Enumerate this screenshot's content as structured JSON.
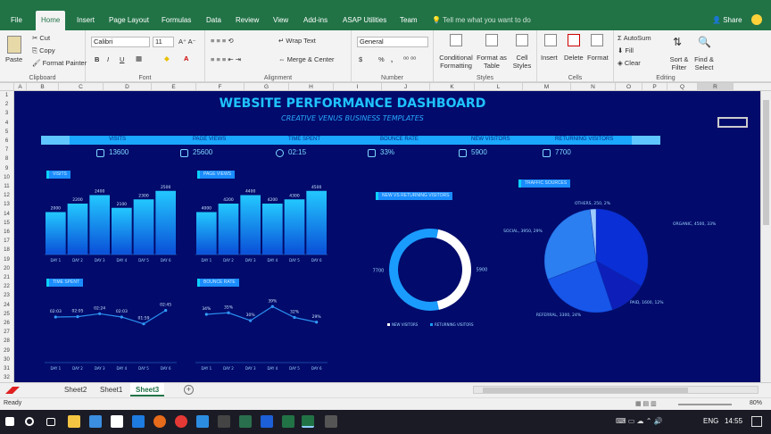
{
  "menu": [
    "File",
    "Home",
    "Insert",
    "Page Layout",
    "Formulas",
    "Data",
    "Review",
    "View",
    "Add-ins",
    "ASAP Utilities",
    "Team"
  ],
  "tell_me": "Tell me what you want to do",
  "share": "Share",
  "ribbon": {
    "clipboard": {
      "paste": "Paste",
      "cut": "Cut",
      "copy": "Copy",
      "format_painter": "Format Painter",
      "label": "Clipboard"
    },
    "font": {
      "name": "Calibri",
      "size": "11",
      "label": "Font",
      "bold": "B",
      "italic": "I",
      "underline": "U"
    },
    "alignment": {
      "wrap": "Wrap Text",
      "merge": "Merge & Center",
      "label": "Alignment"
    },
    "number": {
      "format": "General",
      "label": "Number",
      "percent": "%",
      "comma": ","
    },
    "styles": {
      "conditional": "Conditional Formatting",
      "format_table": "Format as Table",
      "cell_styles": "Cell Styles",
      "label": "Styles"
    },
    "cells": {
      "insert": "Insert",
      "delete": "Delete",
      "format": "Format",
      "label": "Cells"
    },
    "editing": {
      "autosum": "AutoSum",
      "fill": "Fill",
      "clear": "Clear",
      "sort": "Sort & Filter",
      "find": "Find & Select",
      "label": "Editing"
    }
  },
  "columns": [
    "A",
    "B",
    "C",
    "D",
    "E",
    "F",
    "G",
    "H",
    "I",
    "J",
    "K",
    "L",
    "M",
    "N",
    "O",
    "P",
    "Q",
    "R"
  ],
  "rows": [
    "1",
    "2",
    "3",
    "4",
    "5",
    "6",
    "7",
    "8",
    "9",
    "10",
    "11",
    "12",
    "13",
    "14",
    "15",
    "16",
    "17",
    "18",
    "19",
    "20",
    "21",
    "22",
    "23",
    "24",
    "25",
    "26",
    "27",
    "28",
    "29",
    "30",
    "31",
    "32"
  ],
  "dashboard": {
    "title": "WEBSITE PERFORMANCE DASHBOARD",
    "subtitle": "CREATIVE VENUS BUSINESS TEMPLATES",
    "kpis": [
      {
        "label": "VISITS",
        "value": "13600",
        "icon": "user-icon"
      },
      {
        "label": "PAGE VIEWS",
        "value": "25600",
        "icon": "copy-icon"
      },
      {
        "label": "TIME SPENT",
        "value": "02:15",
        "icon": "clock-icon"
      },
      {
        "label": "BOUNCE RATE",
        "value": "33%",
        "icon": "chart-icon"
      },
      {
        "label": "NEW VISITORS",
        "value": "5900",
        "icon": "group-icon"
      },
      {
        "label": "RETURNING VISITORS",
        "value": "7700",
        "icon": "dollar-icon"
      }
    ]
  },
  "chart_data": [
    {
      "type": "bar",
      "title": "VISITS",
      "categories": [
        "DAY 1",
        "DAY 2",
        "DAY 3",
        "DAY 4",
        "DAY 5",
        "DAY 6"
      ],
      "values": [
        2000,
        2200,
        2400,
        2100,
        2300,
        2500
      ],
      "labels": [
        "2000",
        "2200",
        "2400",
        "2100",
        "2300",
        "2500"
      ]
    },
    {
      "type": "bar",
      "title": "PAGE VIEWS",
      "categories": [
        "DAY 1",
        "DAY 2",
        "DAY 3",
        "DAY 4",
        "DAY 5",
        "DAY 6"
      ],
      "values": [
        4000,
        4200,
        4400,
        4200,
        4300,
        4500
      ],
      "labels": [
        "4000",
        "4200",
        "4400",
        "4200",
        "4300",
        "4500"
      ]
    },
    {
      "type": "line",
      "title": "TIME SPENT",
      "categories": [
        "DAY 1",
        "DAY 2",
        "DAY 3",
        "DAY 4",
        "DAY 5",
        "DAY 6"
      ],
      "values": [
        2.03,
        2.05,
        2.24,
        2.03,
        1.59,
        2.45
      ],
      "labels": [
        "02:03",
        "02:05",
        "02:24",
        "02:03",
        "01:59",
        "02:45"
      ]
    },
    {
      "type": "line",
      "title": "BOUNCE RATE",
      "categories": [
        "DAY 1",
        "DAY 2",
        "DAY 3",
        "DAY 4",
        "DAY 5",
        "DAY 6"
      ],
      "values": [
        34,
        35,
        30,
        39,
        32,
        29
      ],
      "labels": [
        "34%",
        "35%",
        "30%",
        "39%",
        "32%",
        "29%"
      ]
    },
    {
      "type": "pie",
      "subtype": "donut",
      "title": "NEW VS RETURNING VISITORS",
      "series": [
        {
          "name": "NEW VISITORS",
          "value": 5900,
          "label": "5900",
          "color": "#ffffff"
        },
        {
          "name": "RETURNING VISITORS",
          "value": 7700,
          "label": "7700",
          "color": "#1a9cff"
        }
      ]
    },
    {
      "type": "pie",
      "title": "TRAFFIC SOURCES",
      "series": [
        {
          "name": "ORGANIC",
          "value": 4500,
          "label": "ORGANIC, 4500, 33%",
          "color": "#0a2fd6"
        },
        {
          "name": "PAID",
          "value": 1600,
          "label": "PAID, 1600, 12%",
          "color": "#0d1fb8"
        },
        {
          "name": "REFERRAL",
          "value": 3300,
          "label": "REFERRAL, 3300, 24%",
          "color": "#1756e8"
        },
        {
          "name": "SOCIAL",
          "value": 3950,
          "label": "SOCIAL, 3950, 29%",
          "color": "#2b7ff0"
        },
        {
          "name": "OTHERS",
          "value": 250,
          "label": "OTHERS, 250, 2%",
          "color": "#9ecbff"
        }
      ]
    }
  ],
  "sheet_tabs": [
    "Sheet2",
    "Sheet1",
    "Sheet3"
  ],
  "status": {
    "ready": "Ready",
    "zoom": "80%"
  },
  "taskbar": {
    "lang": "ENG",
    "time": "14:55"
  }
}
